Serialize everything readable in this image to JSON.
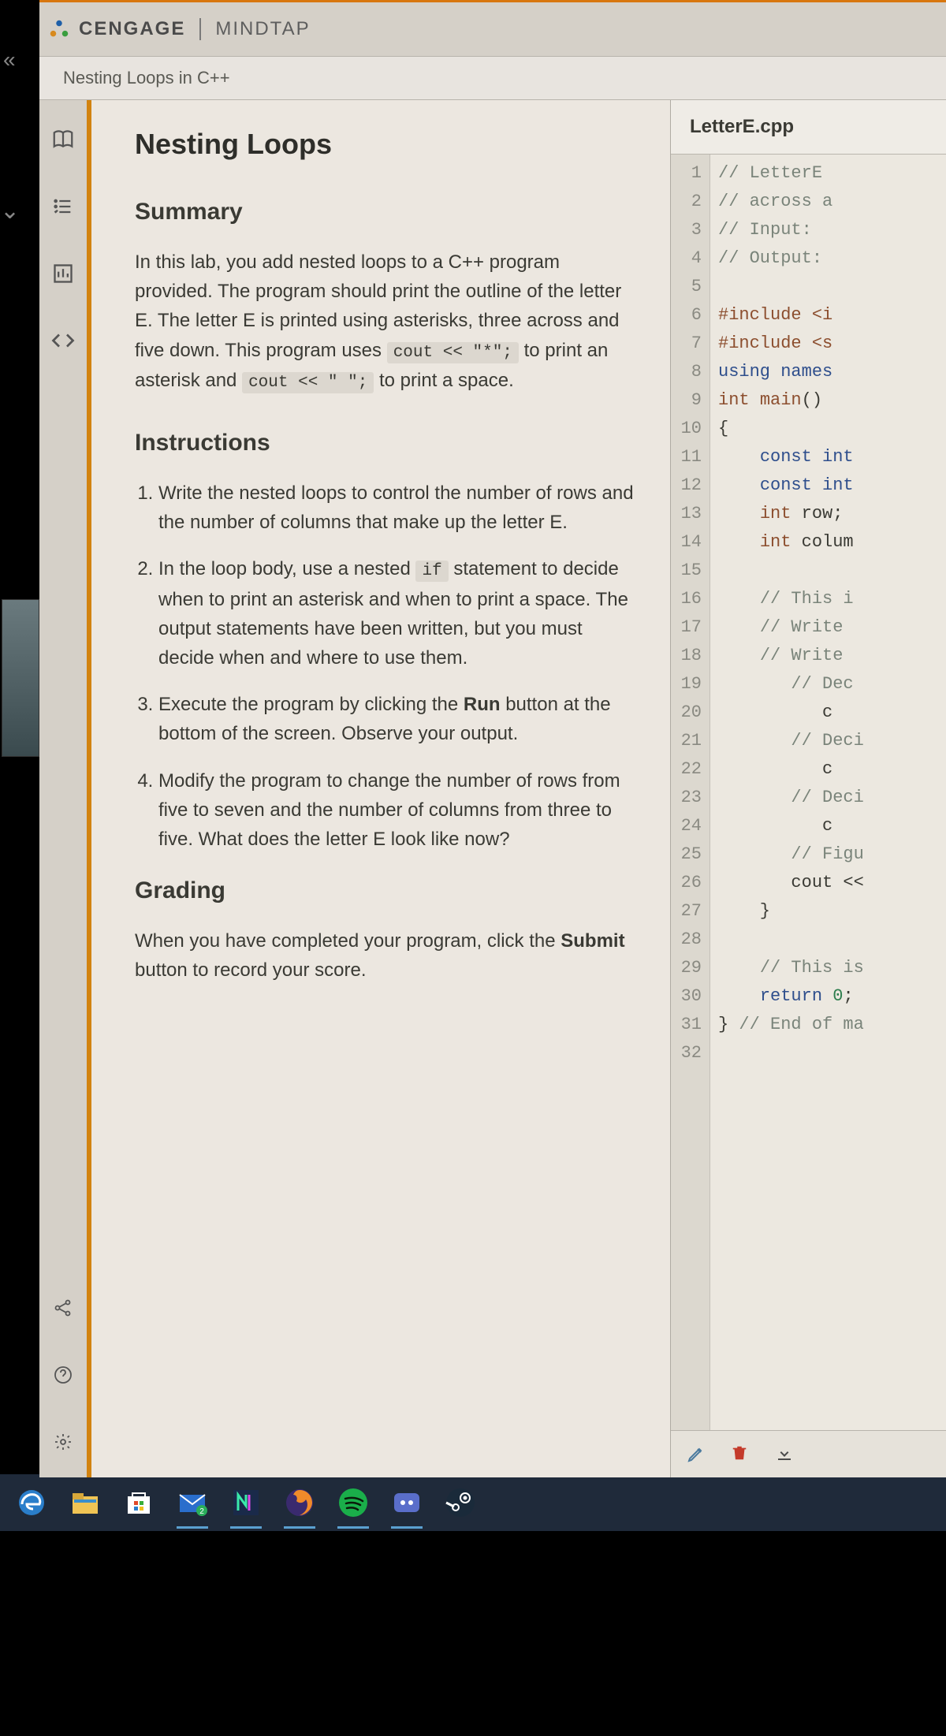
{
  "header": {
    "brand": "CENGAGE",
    "product": "MINDTAP",
    "breadcrumb": "Nesting Loops in C++"
  },
  "content": {
    "title": "Nesting Loops",
    "summary_heading": "Summary",
    "summary_pre": "In this lab, you add nested loops to a C++ program provided. The program should print the outline of the letter E. The letter E is printed using asterisks, three across and five down. This program uses ",
    "summary_code1": "cout << \"*\";",
    "summary_mid": " to print an asterisk and ",
    "summary_code2": "cout << \" \";",
    "summary_post": " to print a space.",
    "instructions_heading": "Instructions",
    "steps": [
      {
        "text": "Write the nested loops to control the number of rows and the number of columns that make up the letter E."
      },
      {
        "pre": "In the loop body, use a nested ",
        "code": "if",
        "post": " statement to decide when to print an asterisk and when to print a space. The output statements have been written, but you must decide when and where to use them."
      },
      {
        "pre": "Execute the program by clicking the ",
        "bold": "Run",
        "post": " button at the bottom of the screen. Observe your output."
      },
      {
        "text": "Modify the program to change the number of rows from five to seven and the number of columns from three to five. What does the letter E look like now?"
      }
    ],
    "grading_heading": "Grading",
    "grading_pre": "When you have completed your program, click the ",
    "grading_bold": "Submit",
    "grading_post": " button to record your score."
  },
  "editor": {
    "filename": "LetterE.cpp",
    "lines": [
      {
        "n": 1,
        "c": "comm",
        "t": "// LetterE"
      },
      {
        "n": 2,
        "c": "comm",
        "t": "// across a"
      },
      {
        "n": 3,
        "c": "comm",
        "t": "// Input:"
      },
      {
        "n": 4,
        "c": "comm",
        "t": "// Output:"
      },
      {
        "n": 5,
        "c": "",
        "t": ""
      },
      {
        "n": 6,
        "c": "pre",
        "t": "#include <i"
      },
      {
        "n": 7,
        "c": "pre",
        "t": "#include <s"
      },
      {
        "n": 8,
        "c": "kw",
        "t": "using names"
      },
      {
        "n": 9,
        "c": "",
        "t": "",
        "seg": [
          {
            "c": "type",
            "t": "int "
          },
          {
            "c": "func",
            "t": "main"
          },
          {
            "c": "",
            "t": "()"
          }
        ]
      },
      {
        "n": 10,
        "c": "",
        "t": "{"
      },
      {
        "n": 11,
        "c": "",
        "t": "    ",
        "seg": [
          {
            "c": "",
            "t": "    "
          },
          {
            "c": "kw",
            "t": "const int"
          }
        ]
      },
      {
        "n": 12,
        "c": "",
        "t": "",
        "seg": [
          {
            "c": "",
            "t": "    "
          },
          {
            "c": "kw",
            "t": "const int"
          }
        ]
      },
      {
        "n": 13,
        "c": "",
        "t": "",
        "seg": [
          {
            "c": "",
            "t": "    "
          },
          {
            "c": "type",
            "t": "int "
          },
          {
            "c": "",
            "t": "row;"
          }
        ]
      },
      {
        "n": 14,
        "c": "",
        "t": "",
        "seg": [
          {
            "c": "",
            "t": "    "
          },
          {
            "c": "type",
            "t": "int "
          },
          {
            "c": "",
            "t": "colum"
          }
        ]
      },
      {
        "n": 15,
        "c": "",
        "t": ""
      },
      {
        "n": 16,
        "c": "",
        "t": "",
        "seg": [
          {
            "c": "",
            "t": "    "
          },
          {
            "c": "comm",
            "t": "// This i"
          }
        ]
      },
      {
        "n": 17,
        "c": "",
        "t": "",
        "seg": [
          {
            "c": "",
            "t": "    "
          },
          {
            "c": "comm",
            "t": "// Write"
          }
        ]
      },
      {
        "n": 18,
        "c": "",
        "t": "",
        "seg": [
          {
            "c": "",
            "t": "    "
          },
          {
            "c": "comm",
            "t": "// Write"
          }
        ]
      },
      {
        "n": 19,
        "c": "",
        "t": "",
        "seg": [
          {
            "c": "",
            "t": "       "
          },
          {
            "c": "comm",
            "t": "// Dec"
          }
        ]
      },
      {
        "n": 20,
        "c": "",
        "t": "",
        "seg": [
          {
            "c": "",
            "t": "          c"
          }
        ]
      },
      {
        "n": 21,
        "c": "",
        "t": "",
        "seg": [
          {
            "c": "",
            "t": "       "
          },
          {
            "c": "comm",
            "t": "// Deci"
          }
        ]
      },
      {
        "n": 22,
        "c": "",
        "t": "",
        "seg": [
          {
            "c": "",
            "t": "          c"
          }
        ]
      },
      {
        "n": 23,
        "c": "",
        "t": "",
        "seg": [
          {
            "c": "",
            "t": "       "
          },
          {
            "c": "comm",
            "t": "// Deci"
          }
        ]
      },
      {
        "n": 24,
        "c": "",
        "t": "",
        "seg": [
          {
            "c": "",
            "t": "          c"
          }
        ]
      },
      {
        "n": 25,
        "c": "",
        "t": "",
        "seg": [
          {
            "c": "",
            "t": "       "
          },
          {
            "c": "comm",
            "t": "// Figu"
          }
        ]
      },
      {
        "n": 26,
        "c": "",
        "t": "",
        "seg": [
          {
            "c": "",
            "t": "       cout <<"
          }
        ]
      },
      {
        "n": 27,
        "c": "",
        "t": "    }"
      },
      {
        "n": 28,
        "c": "",
        "t": ""
      },
      {
        "n": 29,
        "c": "",
        "t": "",
        "seg": [
          {
            "c": "",
            "t": "    "
          },
          {
            "c": "comm",
            "t": "// This is"
          }
        ]
      },
      {
        "n": 30,
        "c": "",
        "t": "",
        "seg": [
          {
            "c": "",
            "t": "    "
          },
          {
            "c": "kw",
            "t": "return "
          },
          {
            "c": "num",
            "t": "0"
          },
          {
            "c": "",
            "t": ";"
          }
        ]
      },
      {
        "n": 31,
        "c": "",
        "t": "",
        "seg": [
          {
            "c": "",
            "t": "} "
          },
          {
            "c": "comm",
            "t": "// End of ma"
          }
        ]
      },
      {
        "n": 32,
        "c": "",
        "t": ""
      }
    ]
  },
  "toolbar": {
    "edit": "edit",
    "delete": "delete",
    "download": "download"
  }
}
